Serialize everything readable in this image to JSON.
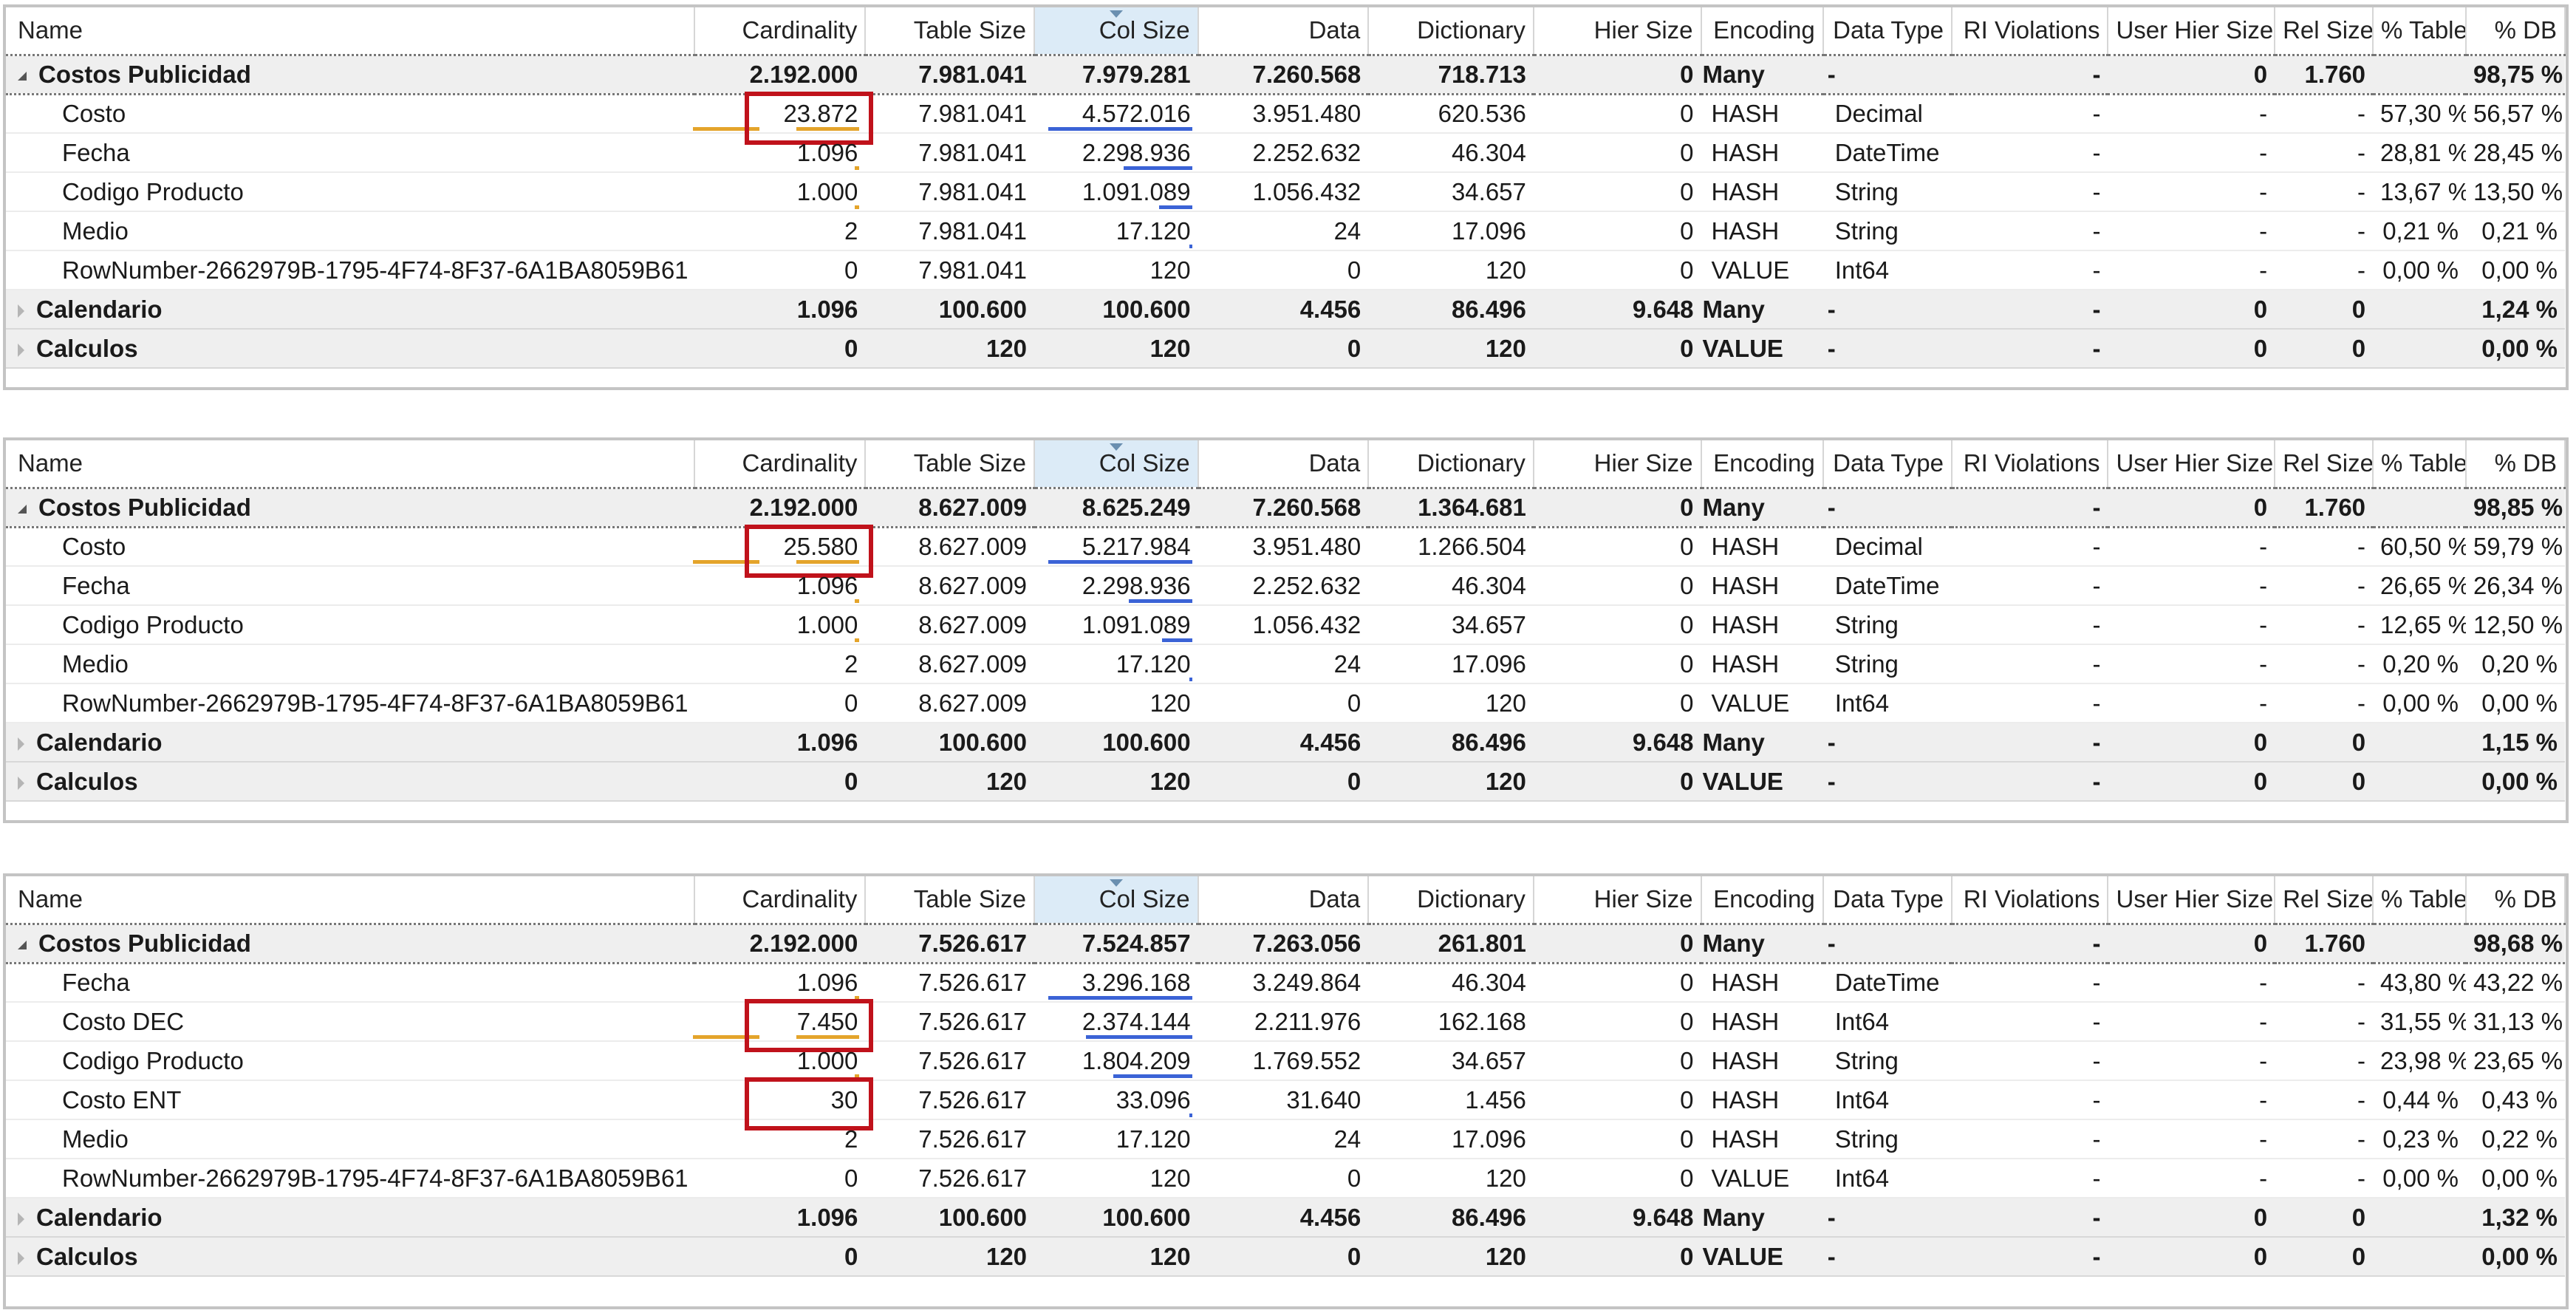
{
  "columns": [
    "Name",
    "Cardinality",
    "Table Size",
    "Col Size",
    "Data",
    "Dictionary",
    "Hier Size",
    "Encoding",
    "Data Type",
    "RI Violations",
    "User Hier Size",
    "Rel Size",
    "% Table",
    "% DB"
  ],
  "colors": {
    "highlight": "#c0121b",
    "cardinality_bar": "#e4a42b",
    "colsize_bar": "#3b63d6",
    "sorted_header": "#dcebf7"
  },
  "panels": [
    {
      "rows": [
        {
          "kind": "group",
          "expanded": true,
          "cells": [
            "Costos Publicidad",
            "2.192.000",
            "7.981.041",
            "7.979.281",
            "7.260.568",
            "718.713",
            "0",
            "Many",
            "-",
            "-",
            "0",
            "1.760",
            "",
            "98,75 %"
          ]
        },
        {
          "kind": "child",
          "cells": [
            "Costo",
            "23.872",
            "7.981.041",
            "4.572.016",
            "3.951.480",
            "620.536",
            "0",
            "HASH",
            "Decimal",
            "-",
            "-",
            "-",
            "57,30 %",
            "56,57 %"
          ],
          "card_bar": 0.9,
          "col_bar": 0.95,
          "highlight": true
        },
        {
          "kind": "child",
          "cells": [
            "Fecha",
            "1.096",
            "7.981.041",
            "2.298.936",
            "2.252.632",
            "46.304",
            "0",
            "HASH",
            "DateTime",
            "-",
            "-",
            "-",
            "28,81 %",
            "28,45 %"
          ],
          "card_bar": 0.05,
          "col_bar": 0.45
        },
        {
          "kind": "child",
          "cells": [
            "Codigo Producto",
            "1.000",
            "7.981.041",
            "1.091.089",
            "1.056.432",
            "34.657",
            "0",
            "HASH",
            "String",
            "-",
            "-",
            "-",
            "13,67 %",
            "13,50 %"
          ],
          "card_bar": 0.04,
          "col_bar": 0.22
        },
        {
          "kind": "child",
          "cells": [
            "Medio",
            "2",
            "7.981.041",
            "17.120",
            "24",
            "17.096",
            "0",
            "HASH",
            "String",
            "-",
            "-",
            "-",
            "0,21 %",
            "0,21 %"
          ],
          "card_bar": 0.0,
          "col_bar": 0.01
        },
        {
          "kind": "child",
          "cells": [
            "RowNumber-2662979B-1795-4F74-8F37-6A1BA8059B61",
            "0",
            "7.981.041",
            "120",
            "0",
            "120",
            "0",
            "VALUE",
            "Int64",
            "-",
            "-",
            "-",
            "0,00 %",
            "0,00 %"
          ],
          "card_bar": 0.0,
          "col_bar": 0.0
        },
        {
          "kind": "group",
          "expanded": false,
          "cells": [
            "Calendario",
            "1.096",
            "100.600",
            "100.600",
            "4.456",
            "86.496",
            "9.648",
            "Many",
            "-",
            "-",
            "0",
            "0",
            "",
            "1,24 %"
          ]
        },
        {
          "kind": "group",
          "expanded": false,
          "cells": [
            "Calculos",
            "0",
            "120",
            "120",
            "0",
            "120",
            "0",
            "VALUE",
            "-",
            "-",
            "0",
            "0",
            "",
            "0,00 %"
          ]
        }
      ]
    },
    {
      "rows": [
        {
          "kind": "group",
          "expanded": true,
          "cells": [
            "Costos Publicidad",
            "2.192.000",
            "8.627.009",
            "8.625.249",
            "7.260.568",
            "1.364.681",
            "0",
            "Many",
            "-",
            "-",
            "0",
            "1.760",
            "",
            "98,85 %"
          ]
        },
        {
          "kind": "child",
          "cells": [
            "Costo",
            "25.580",
            "8.627.009",
            "5.217.984",
            "3.951.480",
            "1.266.504",
            "0",
            "HASH",
            "Decimal",
            "-",
            "-",
            "-",
            "60,50 %",
            "59,79 %"
          ],
          "card_bar": 0.9,
          "col_bar": 0.95,
          "highlight": true
        },
        {
          "kind": "child",
          "cells": [
            "Fecha",
            "1.096",
            "8.627.009",
            "2.298.936",
            "2.252.632",
            "46.304",
            "0",
            "HASH",
            "DateTime",
            "-",
            "-",
            "-",
            "26,65 %",
            "26,34 %"
          ],
          "card_bar": 0.04,
          "col_bar": 0.42
        },
        {
          "kind": "child",
          "cells": [
            "Codigo Producto",
            "1.000",
            "8.627.009",
            "1.091.089",
            "1.056.432",
            "34.657",
            "0",
            "HASH",
            "String",
            "-",
            "-",
            "-",
            "12,65 %",
            "12,50 %"
          ],
          "card_bar": 0.04,
          "col_bar": 0.2
        },
        {
          "kind": "child",
          "cells": [
            "Medio",
            "2",
            "8.627.009",
            "17.120",
            "24",
            "17.096",
            "0",
            "HASH",
            "String",
            "-",
            "-",
            "-",
            "0,20 %",
            "0,20 %"
          ],
          "card_bar": 0.0,
          "col_bar": 0.01
        },
        {
          "kind": "child",
          "cells": [
            "RowNumber-2662979B-1795-4F74-8F37-6A1BA8059B61",
            "0",
            "8.627.009",
            "120",
            "0",
            "120",
            "0",
            "VALUE",
            "Int64",
            "-",
            "-",
            "-",
            "0,00 %",
            "0,00 %"
          ],
          "card_bar": 0.0,
          "col_bar": 0.0
        },
        {
          "kind": "group",
          "expanded": false,
          "cells": [
            "Calendario",
            "1.096",
            "100.600",
            "100.600",
            "4.456",
            "86.496",
            "9.648",
            "Many",
            "-",
            "-",
            "0",
            "0",
            "",
            "1,15 %"
          ]
        },
        {
          "kind": "group",
          "expanded": false,
          "cells": [
            "Calculos",
            "0",
            "120",
            "120",
            "0",
            "120",
            "0",
            "VALUE",
            "-",
            "-",
            "0",
            "0",
            "",
            "0,00 %"
          ]
        }
      ]
    },
    {
      "rows": [
        {
          "kind": "group",
          "expanded": true,
          "cells": [
            "Costos Publicidad",
            "2.192.000",
            "7.526.617",
            "7.524.857",
            "7.263.056",
            "261.801",
            "0",
            "Many",
            "-",
            "-",
            "0",
            "1.760",
            "",
            "98,68 %"
          ]
        },
        {
          "kind": "child",
          "cells": [
            "Fecha",
            "1.096",
            "7.526.617",
            "3.296.168",
            "3.249.864",
            "46.304",
            "0",
            "HASH",
            "DateTime",
            "-",
            "-",
            "-",
            "43,80 %",
            "43,22 %"
          ],
          "card_bar": 0.05,
          "col_bar": 0.95
        },
        {
          "kind": "child",
          "cells": [
            "Costo DEC",
            "7.450",
            "7.526.617",
            "2.374.144",
            "2.211.976",
            "162.168",
            "0",
            "HASH",
            "Int64",
            "-",
            "-",
            "-",
            "31,55 %",
            "31,13 %"
          ],
          "card_bar": 0.9,
          "col_bar": 0.7,
          "highlight": true
        },
        {
          "kind": "child",
          "cells": [
            "Codigo Producto",
            "1.000",
            "7.526.617",
            "1.804.209",
            "1.769.552",
            "34.657",
            "0",
            "HASH",
            "String",
            "-",
            "-",
            "-",
            "23,98 %",
            "23,65 %"
          ],
          "card_bar": 0.05,
          "col_bar": 0.52
        },
        {
          "kind": "child",
          "cells": [
            "Costo ENT",
            "30",
            "7.526.617",
            "33.096",
            "31.640",
            "1.456",
            "0",
            "HASH",
            "Int64",
            "-",
            "-",
            "-",
            "0,44 %",
            "0,43 %"
          ],
          "card_bar": 0.0,
          "col_bar": 0.01,
          "highlight": true
        },
        {
          "kind": "child",
          "cells": [
            "Medio",
            "2",
            "7.526.617",
            "17.120",
            "24",
            "17.096",
            "0",
            "HASH",
            "String",
            "-",
            "-",
            "-",
            "0,23 %",
            "0,22 %"
          ],
          "card_bar": 0.0,
          "col_bar": 0.0
        },
        {
          "kind": "child",
          "cells": [
            "RowNumber-2662979B-1795-4F74-8F37-6A1BA8059B61",
            "0",
            "7.526.617",
            "120",
            "0",
            "120",
            "0",
            "VALUE",
            "Int64",
            "-",
            "-",
            "-",
            "0,00 %",
            "0,00 %"
          ],
          "card_bar": 0.0,
          "col_bar": 0.0
        },
        {
          "kind": "group",
          "expanded": false,
          "cells": [
            "Calendario",
            "1.096",
            "100.600",
            "100.600",
            "4.456",
            "86.496",
            "9.648",
            "Many",
            "-",
            "-",
            "0",
            "0",
            "",
            "1,32 %"
          ]
        },
        {
          "kind": "group",
          "expanded": false,
          "cells": [
            "Calculos",
            "0",
            "120",
            "120",
            "0",
            "120",
            "0",
            "VALUE",
            "-",
            "-",
            "0",
            "0",
            "",
            "0,00 %"
          ]
        }
      ]
    }
  ]
}
